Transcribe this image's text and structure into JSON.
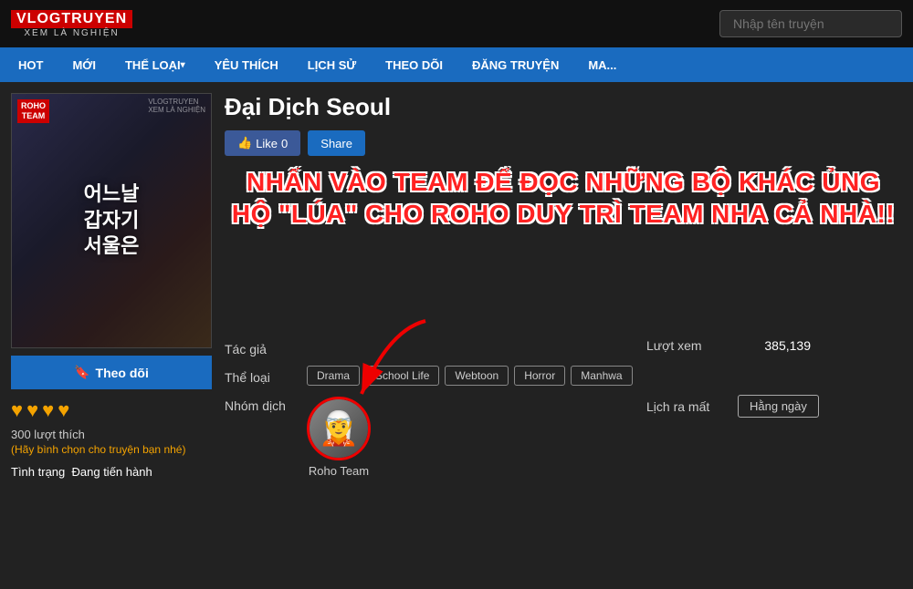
{
  "header": {
    "logo_top": "VLOGTRUYEN",
    "logo_bottom": "XEM LÀ NGHIỆN",
    "search_placeholder": "Nhập tên truyện"
  },
  "nav": {
    "items": [
      {
        "label": "HOT",
        "has_arrow": false
      },
      {
        "label": "MỚI",
        "has_arrow": false
      },
      {
        "label": "THỂ LOẠI",
        "has_arrow": true
      },
      {
        "label": "YÊU THÍCH",
        "has_arrow": false
      },
      {
        "label": "LỊCH SỬ",
        "has_arrow": false
      },
      {
        "label": "THEO DÕI",
        "has_arrow": false
      },
      {
        "label": "ĐĂNG TRUYỆN",
        "has_arrow": false
      },
      {
        "label": "MA...",
        "has_arrow": false
      }
    ]
  },
  "manga": {
    "title": "Đại Dịch Seoul",
    "cover_text": "어느날\n갑자기\n서울은",
    "cover_badge_top": "ROHO\nTEAM",
    "overlay_line1": "NHẤN VÀO TEAM ĐỂ ĐỌC NHỮNG BỘ KHÁC ỦNG",
    "overlay_line2": "HỘ \"LÚA\" CHO ROHO DUY TRÌ TEAM NHA CẢ NHÀ!!",
    "btn_like": "Like",
    "like_count": "0",
    "btn_share": "Share",
    "follow_btn": "Theo dõi",
    "hearts": [
      "♥",
      "♥",
      "♥",
      "♥"
    ],
    "like_votes": "300 lượt thích",
    "vote_cta": "(Hãy bình chọn cho truyện bạn nhé)",
    "status_label": "Tình trạng",
    "status_value": "Đang tiến hành",
    "tac_gia_label": "Tác giả",
    "tac_gia_value": "",
    "luot_xem_label": "Lượt xem",
    "luot_xem_value": "385,139",
    "the_loai_label": "Thể loại",
    "tags": [
      "Drama",
      "School Life",
      "Webtoon",
      "Horror",
      "Manhwa"
    ],
    "nhom_dich_label": "Nhóm dịch",
    "team_name": "Roho Team",
    "lich_ra_mat_label": "Lịch ra mất",
    "lich_ra_mat_value": "Hằng ngày"
  }
}
